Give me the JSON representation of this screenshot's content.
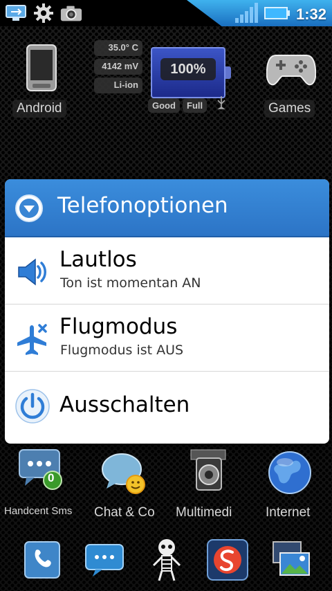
{
  "status_bar": {
    "time": "1:32",
    "icons": [
      "usb-icon",
      "settings-icon",
      "camera-icon",
      "signal-icon",
      "battery-icon"
    ]
  },
  "home": {
    "top_shortcuts": [
      {
        "label": "Android",
        "icon": "phone-icon"
      },
      {
        "label": "Games",
        "icon": "gamepad-icon"
      }
    ],
    "battery_widget": {
      "temperature": "35.0° C",
      "voltage": "4142 mV",
      "type": "Li-ion",
      "percent": "100%",
      "health": "Good",
      "status": "Full",
      "level": 1.0
    },
    "bottom_shortcuts": [
      {
        "label": "Handcent Sms",
        "icon": "sms-icon",
        "badge": "0"
      },
      {
        "label": "Chat & Co",
        "icon": "chat-icon"
      },
      {
        "label": "Multimedi",
        "icon": "multimedia-icon"
      },
      {
        "label": "Internet",
        "icon": "globe-icon"
      }
    ],
    "dock": [
      "phone-app-icon",
      "messages-icon",
      "skeleton-icon",
      "swype-icon",
      "gallery-icon"
    ]
  },
  "dialog": {
    "title": "Telefonoptionen",
    "options": [
      {
        "title": "Lautlos",
        "subtitle": "Ton ist momentan AN",
        "icon": "speaker-icon"
      },
      {
        "title": "Flugmodus",
        "subtitle": "Flugmodus ist AUS",
        "icon": "airplane-icon"
      },
      {
        "title": "Ausschalten",
        "icon": "power-icon"
      }
    ]
  },
  "colors": {
    "dialog_header": "#2f7ccb",
    "status_accent": "#2e93e0"
  }
}
